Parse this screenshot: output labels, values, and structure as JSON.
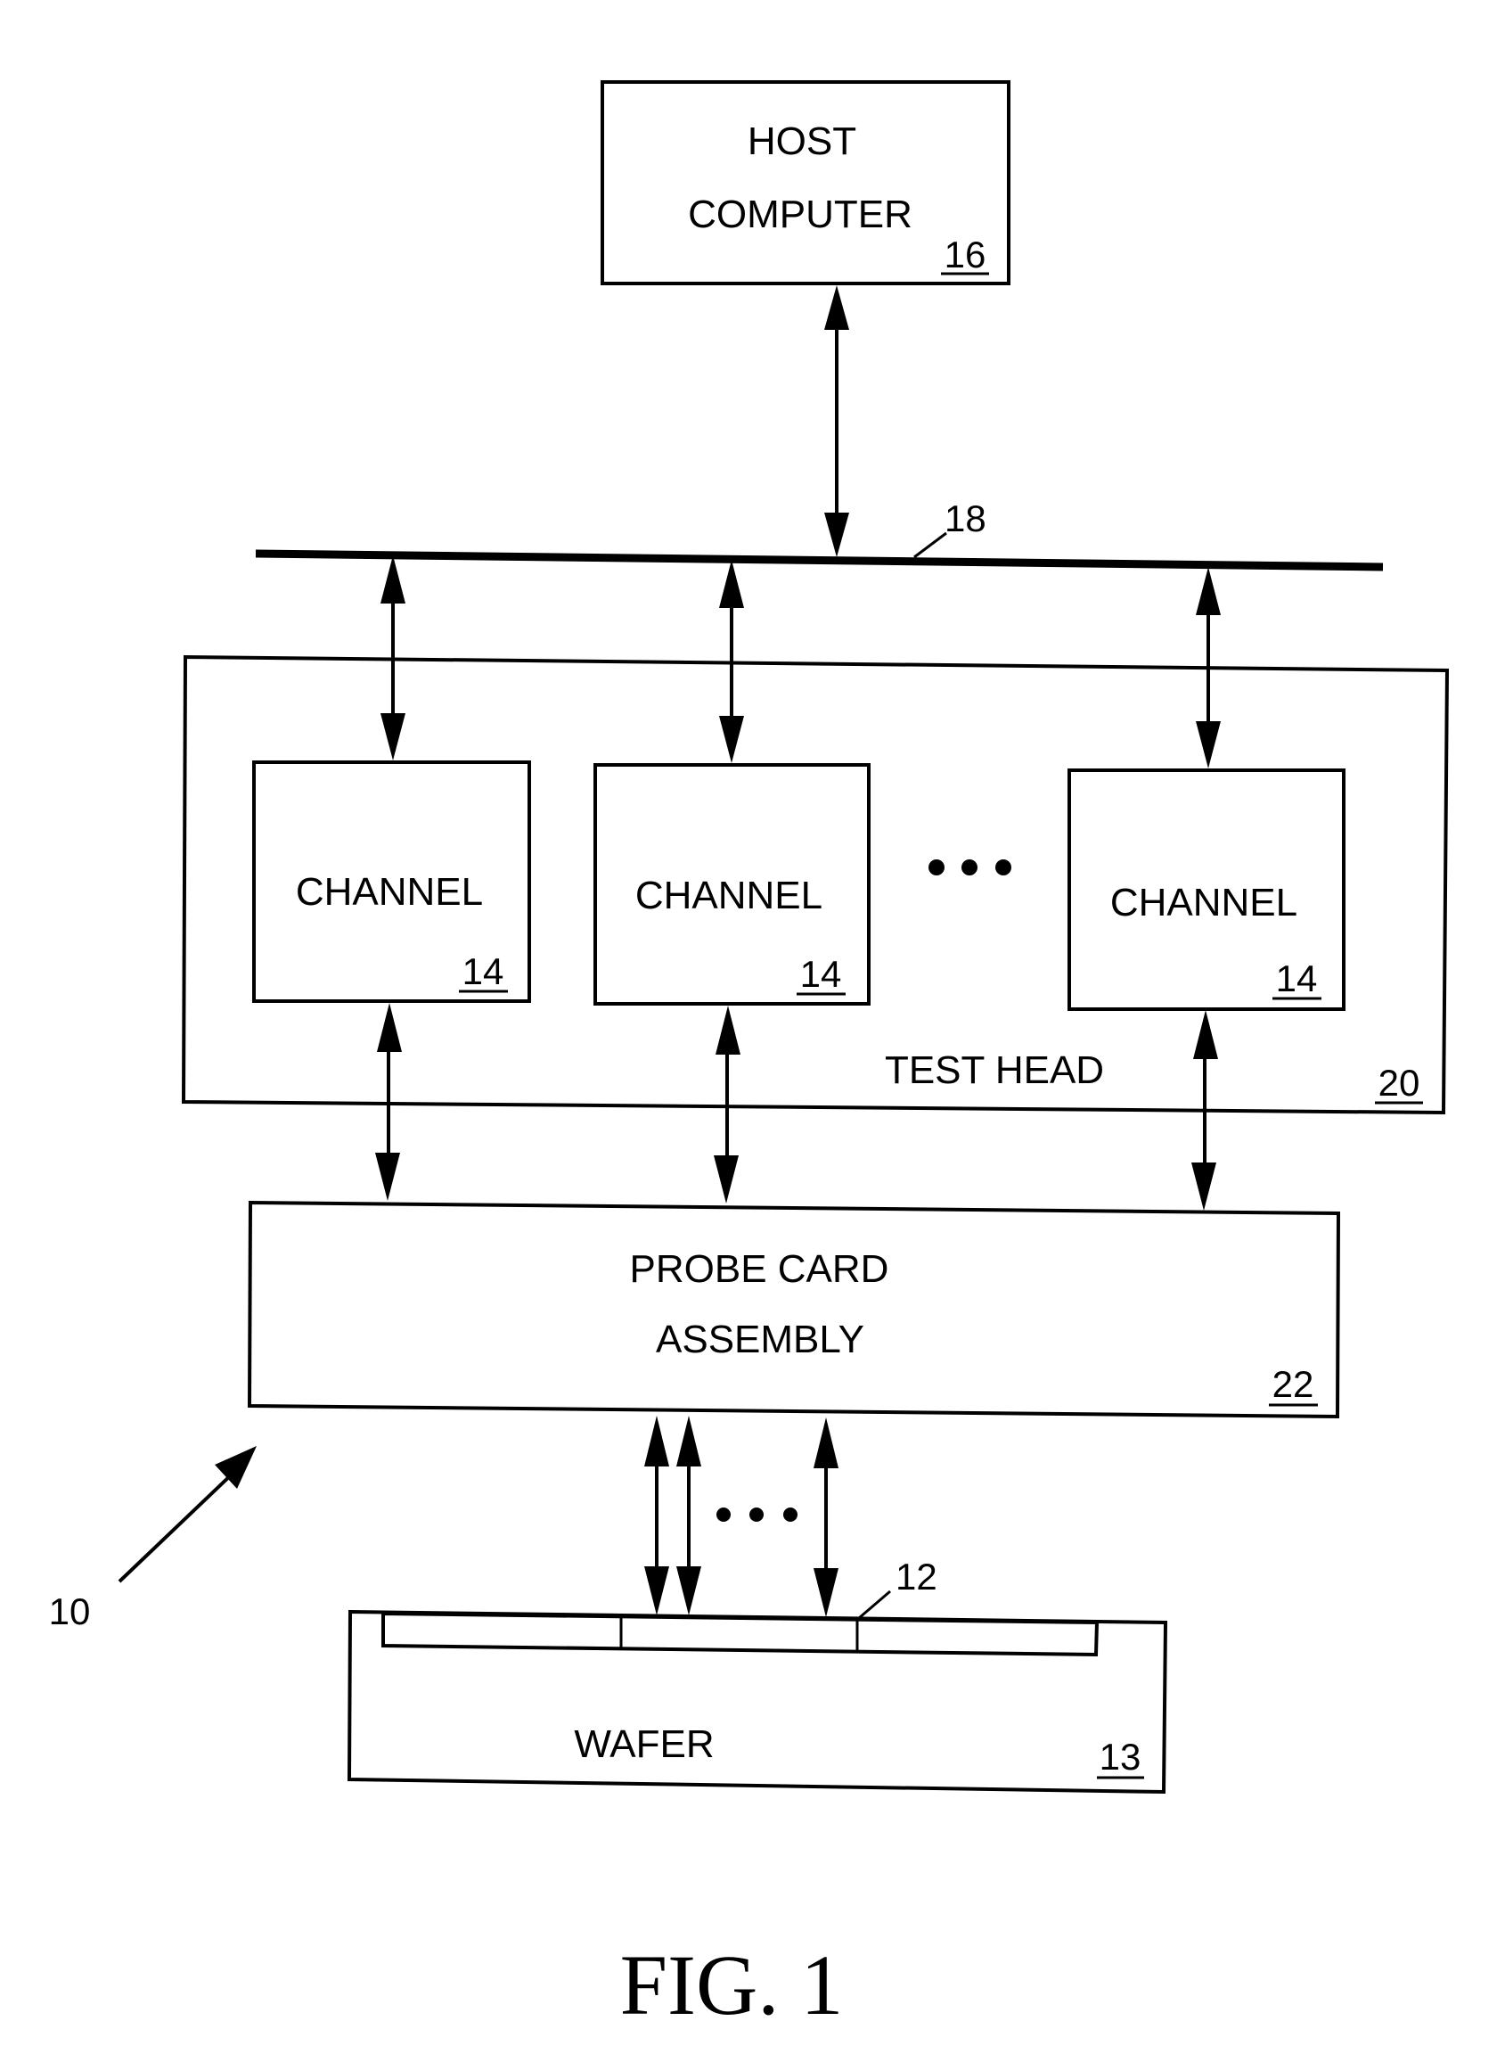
{
  "figure": {
    "caption": "FIG. 1",
    "system_ref": "10",
    "colors": {
      "ink": "#000000",
      "paper": "#ffffff"
    }
  },
  "host": {
    "line1": "HOST",
    "line2": "COMPUTER",
    "ref": "16"
  },
  "bus": {
    "ref": "18"
  },
  "test_head": {
    "label": "TEST HEAD",
    "ref": "20"
  },
  "channels": [
    {
      "label": "CHANNEL",
      "ref": "14"
    },
    {
      "label": "CHANNEL",
      "ref": "14"
    },
    {
      "label": "CHANNEL",
      "ref": "14"
    }
  ],
  "channel_ellipsis": "•••",
  "probe_card": {
    "line1": "PROBE CARD",
    "line2": "ASSEMBLY",
    "ref": "22"
  },
  "probe_ellipsis": "•••",
  "wafer": {
    "label": "WAFER",
    "ref": "13",
    "dut_ref": "12"
  }
}
